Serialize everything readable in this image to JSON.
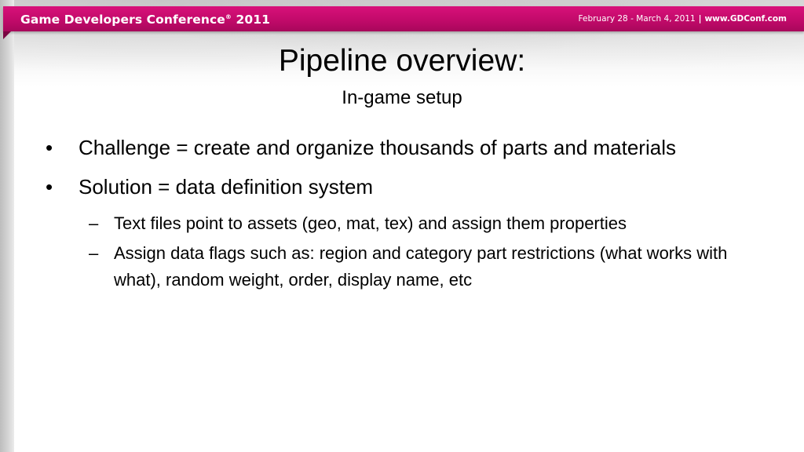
{
  "header": {
    "conference_name": "Game Developers Conference",
    "registered_mark": "®",
    "year": "2011",
    "dates": "February 28 - March 4, 2011",
    "separator": "|",
    "url": "www.GDConf.com",
    "brand_color": "#c20a6a"
  },
  "slide": {
    "title": "Pipeline overview:",
    "subtitle": "In-game setup",
    "bullets": [
      {
        "marker": "•",
        "text": "Challenge = create and organize thousands of parts and materials"
      },
      {
        "marker": "•",
        "text": "Solution = data definition system",
        "subitems": [
          {
            "marker": "–",
            "text": "Text files point to assets (geo, mat, tex) and assign them properties"
          },
          {
            "marker": "–",
            "text": "Assign data flags such as: region and category part restrictions (what works with what), random weight, order, display name, etc"
          }
        ]
      }
    ]
  }
}
